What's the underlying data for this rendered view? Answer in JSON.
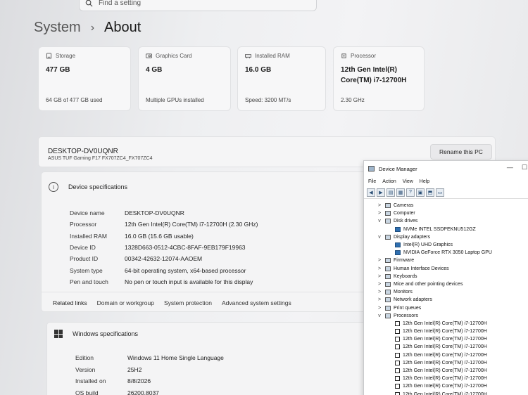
{
  "search": {
    "placeholder": "Find a setting"
  },
  "header": {
    "section": "System",
    "page": "About"
  },
  "tiles": [
    {
      "title": "Storage",
      "value": "477 GB",
      "sub": "64 GB of 477 GB used"
    },
    {
      "title": "Graphics Card",
      "value": "4 GB",
      "sub": "Multiple GPUs installed"
    },
    {
      "title": "Installed RAM",
      "value": "16.0 GB",
      "sub": "Speed: 3200 MT/s"
    },
    {
      "title": "Processor",
      "value": "12th Gen Intel(R) Core(TM) i7-12700H",
      "sub": "2.30 GHz"
    }
  ],
  "pc": {
    "name": "DESKTOP-DV0UQNR",
    "model": "ASUS TUF Gaming F17 FX707ZC4_FX707ZC4",
    "rename_label": "Rename this PC"
  },
  "device_spec": {
    "title": "Device specifications",
    "rows": [
      {
        "k": "Device name",
        "v": "DESKTOP-DV0UQNR"
      },
      {
        "k": "Processor",
        "v": "12th Gen Intel(R) Core(TM) i7-12700H (2.30 GHz)"
      },
      {
        "k": "Installed RAM",
        "v": "16.0 GB (15.6 GB usable)"
      },
      {
        "k": "Device ID",
        "v": "1328D663-0512-4CBC-8FAF-9EB179F19963"
      },
      {
        "k": "Product ID",
        "v": "00342-42632-12074-AAOEM"
      },
      {
        "k": "System type",
        "v": "64-bit operating system, x64-based processor"
      },
      {
        "k": "Pen and touch",
        "v": "No pen or touch input is available for this display"
      }
    ],
    "related_label": "Related links",
    "links": [
      "Domain or workgroup",
      "System protection",
      "Advanced system settings"
    ]
  },
  "windows_spec": {
    "title": "Windows specifications",
    "rows": [
      {
        "k": "Edition",
        "v": "Windows 11 Home Single Language"
      },
      {
        "k": "Version",
        "v": "25H2"
      },
      {
        "k": "Installed on",
        "v": "8/8/2026"
      },
      {
        "k": "OS build",
        "v": "26200.8037"
      }
    ]
  },
  "device_manager": {
    "title": "Device Manager",
    "menu": [
      "File",
      "Action",
      "View",
      "Help"
    ],
    "tree": [
      {
        "label": "Cameras",
        "chev": ">",
        "type": "cat"
      },
      {
        "label": "Computer",
        "chev": ">",
        "type": "cat"
      },
      {
        "label": "Disk drives",
        "chev": "v",
        "type": "cat"
      },
      {
        "label": "NVMe INTEL SSDPEKNU512GZ",
        "chev": "",
        "type": "child"
      },
      {
        "label": "Display adapters",
        "chev": "v",
        "type": "cat"
      },
      {
        "label": "Intel(R) UHD Graphics",
        "chev": "",
        "type": "child"
      },
      {
        "label": "NVIDIA GeForce RTX 3050 Laptop GPU",
        "chev": "",
        "type": "child"
      },
      {
        "label": "Firmware",
        "chev": ">",
        "type": "cat"
      },
      {
        "label": "Human Interface Devices",
        "chev": ">",
        "type": "cat"
      },
      {
        "label": "Keyboards",
        "chev": ">",
        "type": "cat"
      },
      {
        "label": "Mice and other pointing devices",
        "chev": ">",
        "type": "cat"
      },
      {
        "label": "Monitors",
        "chev": ">",
        "type": "cat"
      },
      {
        "label": "Network adapters",
        "chev": ">",
        "type": "cat"
      },
      {
        "label": "Print queues",
        "chev": ">",
        "type": "cat"
      },
      {
        "label": "Processors",
        "chev": "v",
        "type": "cat"
      },
      {
        "label": "12th Gen Intel(R) Core(TM) i7-12700H",
        "chev": "",
        "type": "cpu"
      },
      {
        "label": "12th Gen Intel(R) Core(TM) i7-12700H",
        "chev": "",
        "type": "cpu"
      },
      {
        "label": "12th Gen Intel(R) Core(TM) i7-12700H",
        "chev": "",
        "type": "cpu"
      },
      {
        "label": "12th Gen Intel(R) Core(TM) i7-12700H",
        "chev": "",
        "type": "cpu"
      },
      {
        "label": "12th Gen Intel(R) Core(TM) i7-12700H",
        "chev": "",
        "type": "cpu"
      },
      {
        "label": "12th Gen Intel(R) Core(TM) i7-12700H",
        "chev": "",
        "type": "cpu"
      },
      {
        "label": "12th Gen Intel(R) Core(TM) i7-12700H",
        "chev": "",
        "type": "cpu"
      },
      {
        "label": "12th Gen Intel(R) Core(TM) i7-12700H",
        "chev": "",
        "type": "cpu"
      },
      {
        "label": "12th Gen Intel(R) Core(TM) i7-12700H",
        "chev": "",
        "type": "cpu"
      },
      {
        "label": "12th Gen Intel(R) Core(TM) i7-12700H",
        "chev": "",
        "type": "cpu"
      }
    ]
  }
}
